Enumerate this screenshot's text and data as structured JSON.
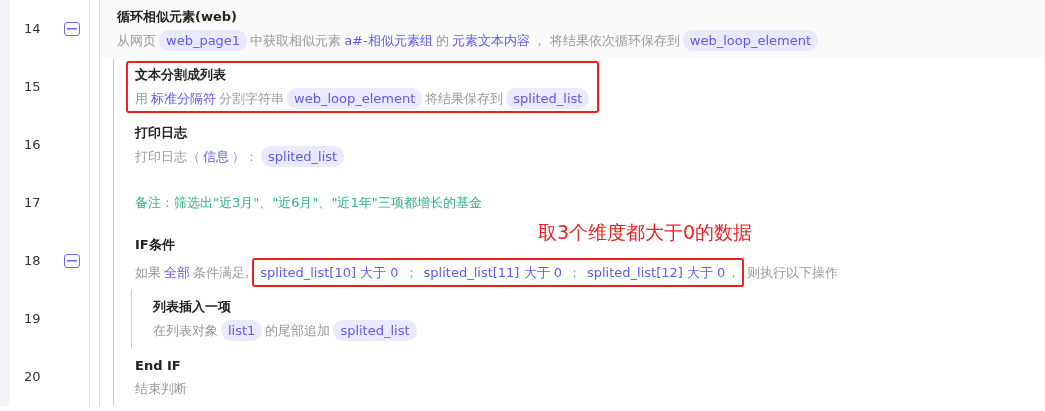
{
  "steps": [
    {
      "line": "14",
      "expanded": true,
      "title": "循环相似元素(web)",
      "highlighted": false,
      "description": [
        {
          "kind": "text",
          "text": "从网页"
        },
        {
          "kind": "var",
          "text": "web_page1"
        },
        {
          "kind": "text",
          "text": "中获取相似元素"
        },
        {
          "kind": "keyword",
          "text": "a#-相似元素组"
        },
        {
          "kind": "text",
          "text": "的"
        },
        {
          "kind": "keyword",
          "text": "元素文本内容"
        },
        {
          "kind": "text",
          "text": "， 将结果依次循环保存到"
        },
        {
          "kind": "var",
          "text": "web_loop_element"
        }
      ],
      "children": [
        {
          "line": "15",
          "title": "文本分割成列表",
          "highlighted": true,
          "description": [
            {
              "kind": "text",
              "text": "用"
            },
            {
              "kind": "keyword",
              "text": "标准分隔符"
            },
            {
              "kind": "text",
              "text": "分割字符串"
            },
            {
              "kind": "var",
              "text": "web_loop_element"
            },
            {
              "kind": "text",
              "text": "将结果保存到"
            },
            {
              "kind": "var",
              "text": "splited_list"
            }
          ]
        },
        {
          "line": "16",
          "title": "打印日志",
          "highlighted": false,
          "description": [
            {
              "kind": "text",
              "text": "打印日志（"
            },
            {
              "kind": "keyword",
              "text": "信息"
            },
            {
              "kind": "text",
              "text": "）："
            },
            {
              "kind": "var",
              "text": "splited_list"
            }
          ]
        },
        {
          "line": "17",
          "highlighted": false,
          "description": [
            {
              "kind": "note",
              "text": "备注：筛选出\"近3月\"、\"近6月\"、\"近1年\"三项都增长的基金"
            }
          ]
        },
        {
          "line": "18",
          "expanded": true,
          "title": "IF条件",
          "highlighted": false,
          "annotation": "取3个维度都大于0的数据",
          "description": [
            {
              "kind": "text",
              "text": "如果"
            },
            {
              "kind": "keyword",
              "text": "全部"
            },
            {
              "kind": "text",
              "text": "条件满足,"
            },
            {
              "kind": "boxed",
              "parts": [
                {
                  "kind": "keyword",
                  "text": "splited_list[10] 大于 0"
                },
                {
                  "kind": "text",
                  "text": "；"
                },
                {
                  "kind": "keyword",
                  "text": "splited_list[11] 大于 0"
                },
                {
                  "kind": "text",
                  "text": "；"
                },
                {
                  "kind": "keyword",
                  "text": "splited_list[12] 大于 0"
                },
                {
                  "kind": "text",
                  "text": ","
                }
              ]
            },
            {
              "kind": "text",
              "text": "则执行以下操作"
            }
          ],
          "children": [
            {
              "line": "19",
              "title": "列表插入一项",
              "highlighted": false,
              "description": [
                {
                  "kind": "text",
                  "text": "在列表对象"
                },
                {
                  "kind": "var",
                  "text": "list1"
                },
                {
                  "kind": "text",
                  "text": "的尾部追加"
                },
                {
                  "kind": "var",
                  "text": "splited_list"
                }
              ]
            }
          ]
        },
        {
          "line": "20",
          "title": "End IF",
          "highlighted": false,
          "description": [
            {
              "kind": "text",
              "text": "结束判断"
            }
          ]
        }
      ]
    }
  ]
}
